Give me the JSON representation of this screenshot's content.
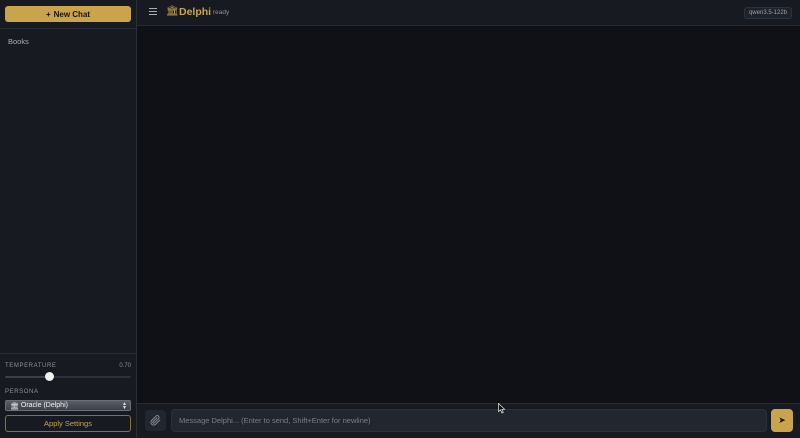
{
  "sidebar": {
    "new_chat_label": "New Chat",
    "new_chat_icon": "+",
    "conversations": [
      "Books"
    ],
    "temperature_label": "TEMPERATURE",
    "temperature_value": "0.70",
    "temperature_level": 0.35,
    "persona_label": "PERSONA",
    "persona_icon": "🏛",
    "persona_selected": "Oracle (Delphi)",
    "apply_label": "Apply Settings"
  },
  "header": {
    "brand_icon": "🏛",
    "brand": "Delphi",
    "status": "ready",
    "model": "qwen3.5-122b"
  },
  "composer": {
    "placeholder": "Message Delphi... (Enter to send, Shift+Enter for newline)",
    "send_icon": "➤"
  },
  "colors": {
    "accent": "#c9a44c",
    "background": "#0f1117",
    "panel": "#171a21"
  },
  "icons": [
    "menu-icon",
    "bank-icon",
    "paperclip-icon",
    "send-icon",
    "plus-icon"
  ]
}
